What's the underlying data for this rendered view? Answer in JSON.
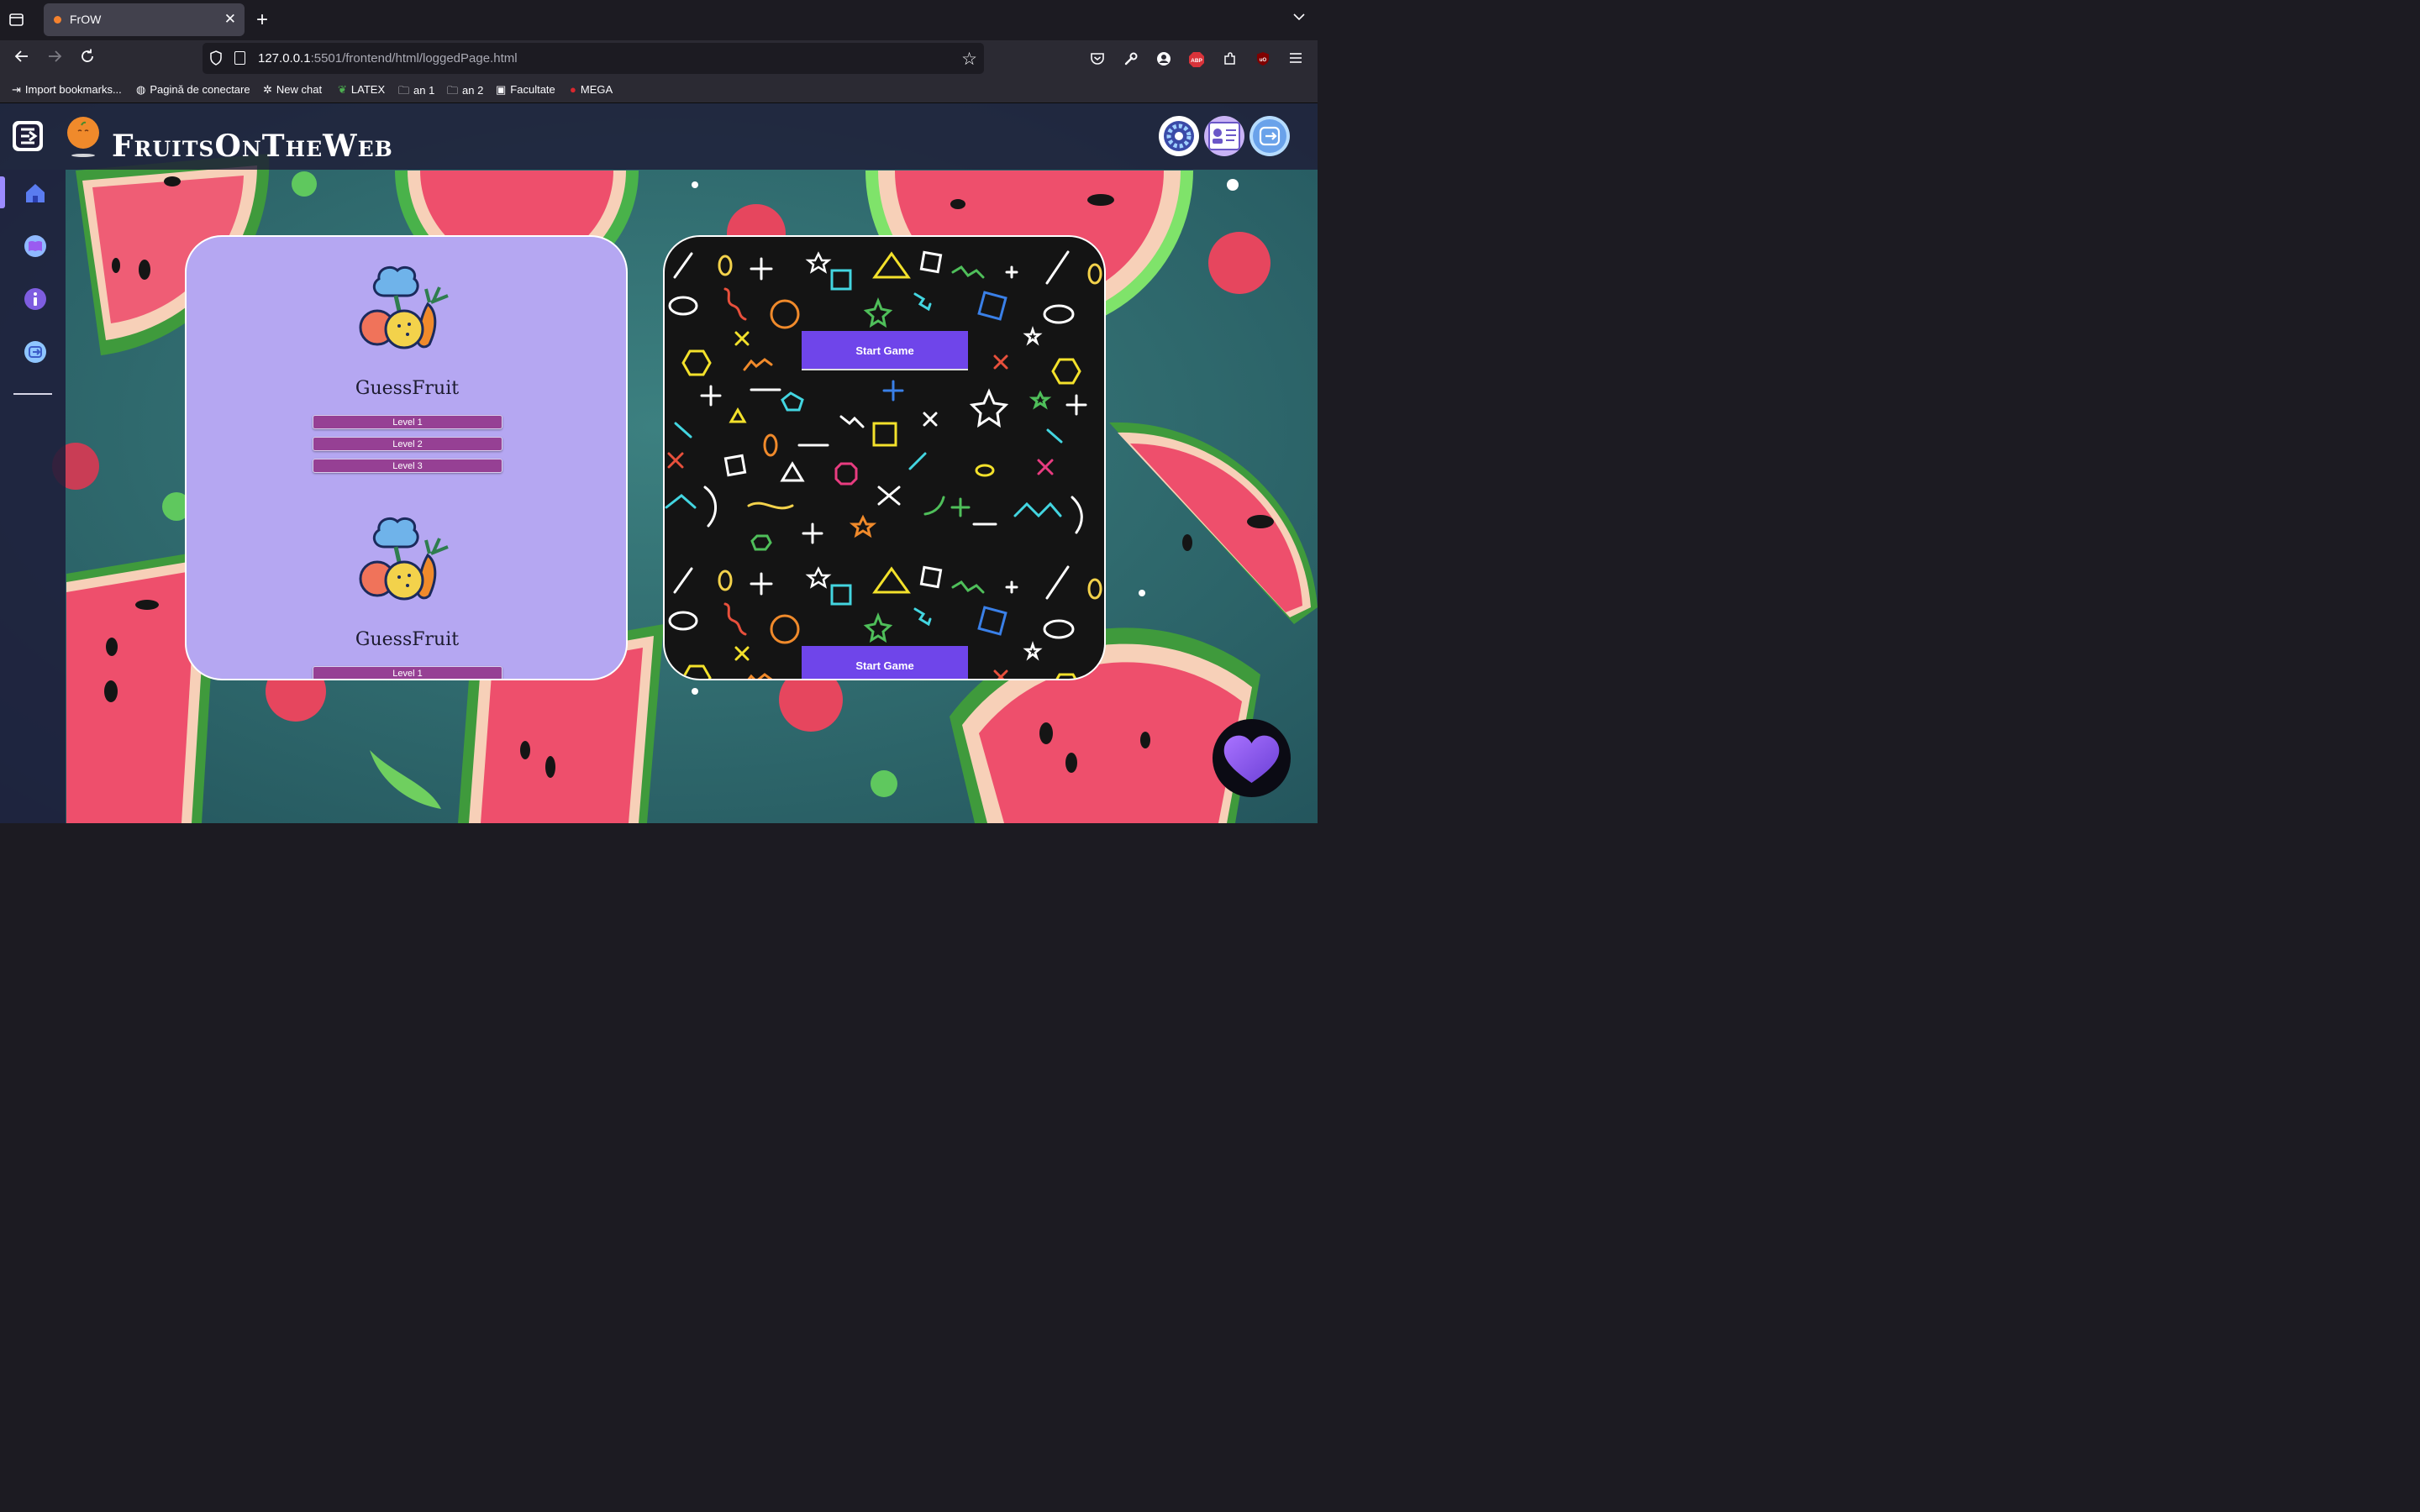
{
  "browser": {
    "tab_title": "FrOW",
    "url_host": "127.0.0.1",
    "url_rest": ":5501/frontend/html/loggedPage.html",
    "bookmarks": [
      {
        "label": "Import bookmarks...",
        "icon": "import-icon"
      },
      {
        "label": "Pagină de conectare",
        "icon": "globe-icon"
      },
      {
        "label": "New chat",
        "icon": "chatgpt-icon"
      },
      {
        "label": "LATEX",
        "icon": "overleaf-icon"
      },
      {
        "label": "an 1",
        "icon": "folder-icon"
      },
      {
        "label": "an 2",
        "icon": "folder-icon"
      },
      {
        "label": "Facultate",
        "icon": "notion-icon"
      },
      {
        "label": "MEGA",
        "icon": "mega-icon"
      }
    ]
  },
  "app": {
    "brand": "FruitsOnTheWeb",
    "colors": {
      "card": "#b5a7f2",
      "level_button": "#964094",
      "start_button": "#6f45ea"
    }
  },
  "games": [
    {
      "title": "GuessFruit",
      "levels": [
        "Level 1",
        "Level 2",
        "Level 3"
      ]
    },
    {
      "title": "GuessFruit",
      "levels": [
        "Level 1"
      ]
    }
  ],
  "start_buttons": [
    "Start Game",
    "Start Game"
  ]
}
